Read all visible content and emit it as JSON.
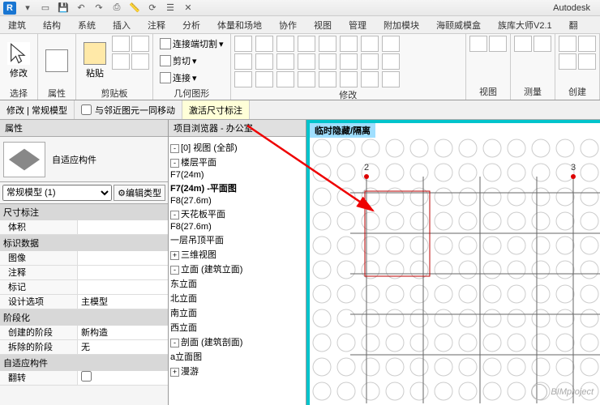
{
  "brand": "Autodesk",
  "logo": "R",
  "ribbon_tabs": [
    "建筑",
    "结构",
    "系统",
    "插入",
    "注释",
    "分析",
    "体量和场地",
    "协作",
    "视图",
    "管理",
    "附加模块",
    "海颐威模盒",
    "族库大师V2.1",
    "翻"
  ],
  "ribbon": {
    "panel_select": {
      "main": "修改",
      "label": "选择"
    },
    "panel_props": {
      "label": "属性"
    },
    "panel_clip": {
      "paste": "粘贴",
      "label": "剪贴板"
    },
    "panel_geom": {
      "cut": "连接端切割",
      "trim": "剪切",
      "join": "连接",
      "label": "几何图形"
    },
    "panel_modify": {
      "label": "修改"
    },
    "panel_view": {
      "label": "视图"
    },
    "panel_measure": {
      "label": "测量"
    },
    "panel_create": {
      "label": "创建"
    }
  },
  "optbar": {
    "modify": "修改 | 常规模型",
    "checkbox": "与邻近图元一同移动",
    "active": "激活尺寸标注"
  },
  "props": {
    "title": "属性",
    "family": "自适应构件",
    "selector": "常规模型 (1)",
    "edittype": "编辑类型",
    "groups": {
      "dim": "尺寸标注",
      "id": "标识数据",
      "phase": "阶段化",
      "adapt": "自适应构件"
    },
    "rows": {
      "volume": "体积",
      "image": "图像",
      "comment": "注释",
      "mark": "标记",
      "designopt_k": "设计选项",
      "designopt_v": "主模型",
      "created_k": "创建的阶段",
      "created_v": "新构造",
      "demo_k": "拆除的阶段",
      "demo_v": "无",
      "flip": "翻转"
    }
  },
  "browser": {
    "title": "项目浏览器 - 办公室",
    "views": "视图 (全部)",
    "floor_plan": "楼层平面",
    "fp1": "F7(24m)",
    "fp2": "F7(24m) -平面图",
    "fp3": "F8(27.6m)",
    "ceiling": "天花板平面",
    "cp1": "F8(27.6m)",
    "cp2": "一层吊顶平面",
    "threeD": "三维视图",
    "elev": "立面 (建筑立面)",
    "e1": "东立面",
    "e2": "北立面",
    "e3": "南立面",
    "e4": "西立面",
    "section": "剖面 (建筑剖面)",
    "s1": "a立面图",
    "walk": "漫游"
  },
  "viewport": {
    "hint": "临时隐藏/隔离",
    "g1": "2",
    "g2": "3",
    "watermark": "BIMproject"
  }
}
